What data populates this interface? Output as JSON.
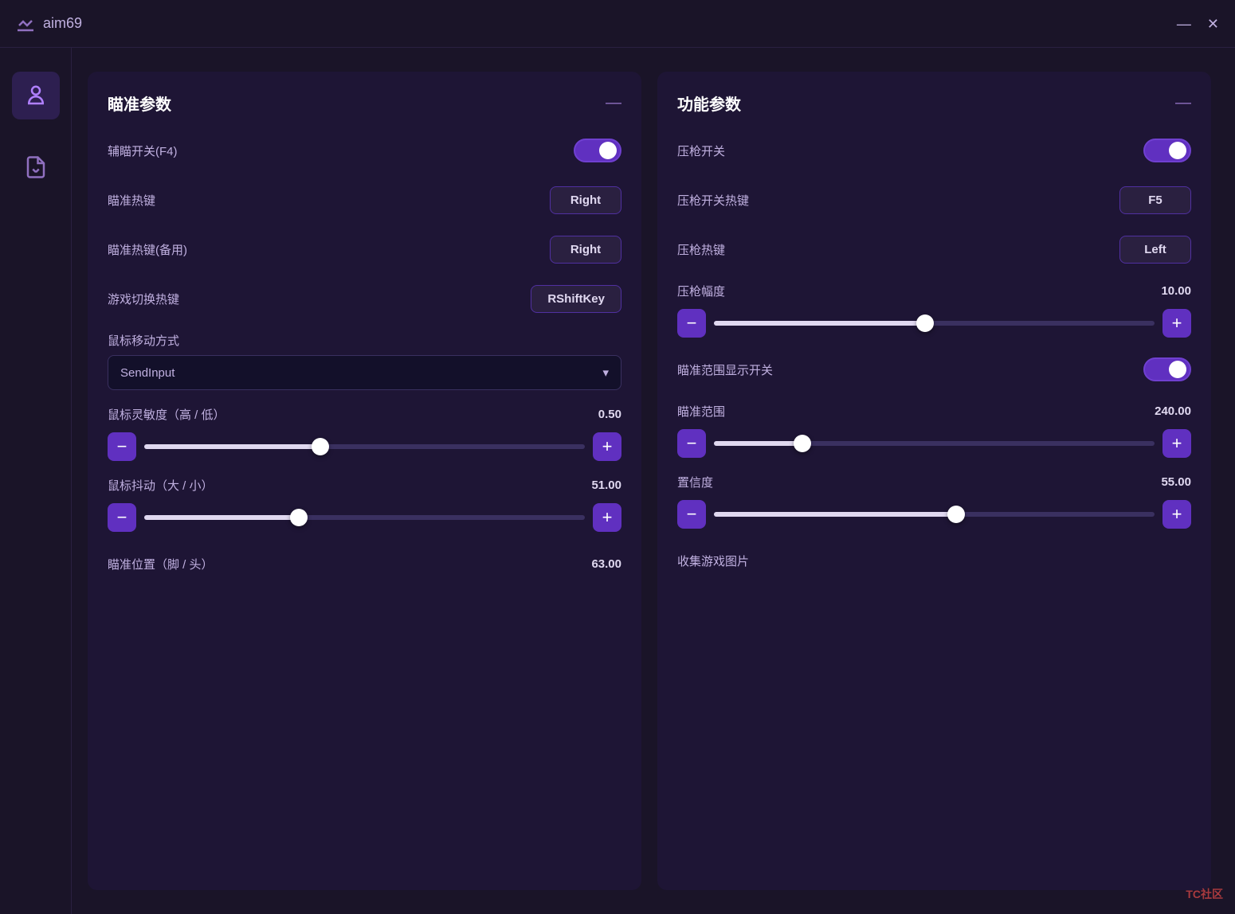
{
  "titleBar": {
    "title": "aim69",
    "minimizeLabel": "—",
    "closeLabel": "✕"
  },
  "sidebar": {
    "items": [
      {
        "id": "person",
        "icon": "person",
        "active": true
      },
      {
        "id": "file",
        "icon": "file",
        "active": false
      }
    ]
  },
  "leftPanel": {
    "title": "瞄准参数",
    "collapseIcon": "—",
    "rows": [
      {
        "label": "辅瞄开关(F4)",
        "type": "toggle",
        "value": true
      },
      {
        "label": "瞄准热键",
        "type": "keybtn",
        "value": "Right"
      },
      {
        "label": "瞄准热键(备用)",
        "type": "keybtn",
        "value": "Right"
      },
      {
        "label": "游戏切换热键",
        "type": "keybtn",
        "value": "RShiftKey"
      }
    ],
    "mouseMoveLabel": "鼠标移动方式",
    "mouseMoveValue": "SendInput",
    "sliders": [
      {
        "label": "鼠标灵敏度（高 / 低）",
        "value": "0.50",
        "fillPercent": 40,
        "thumbPercent": 40
      },
      {
        "label": "鼠标抖动（大 / 小）",
        "value": "51.00",
        "fillPercent": 35,
        "thumbPercent": 35
      }
    ],
    "aimPositionLabel": "瞄准位置（脚 / 头）",
    "aimPositionValue": "63.00"
  },
  "rightPanel": {
    "title": "功能参数",
    "collapseIcon": "—",
    "rows": [
      {
        "label": "压枪开关",
        "type": "toggle",
        "value": true
      },
      {
        "label": "压枪开关热键",
        "type": "keybtn",
        "value": "F5"
      },
      {
        "label": "压枪热键",
        "type": "keybtn",
        "value": "Left"
      }
    ],
    "sliders": [
      {
        "label": "压枪幅度",
        "value": "10.00",
        "fillPercent": 48,
        "thumbPercent": 48
      },
      {
        "label": "瞄准范围",
        "value": "240.00",
        "fillPercent": 20,
        "thumbPercent": 20
      },
      {
        "label": "置信度",
        "value": "55.00",
        "fillPercent": 55,
        "thumbPercent": 55
      }
    ],
    "aimRangeToggleLabel": "瞄准范围显示开关",
    "aimRangeToggleValue": true,
    "collectLabel": "收集游戏图片"
  }
}
